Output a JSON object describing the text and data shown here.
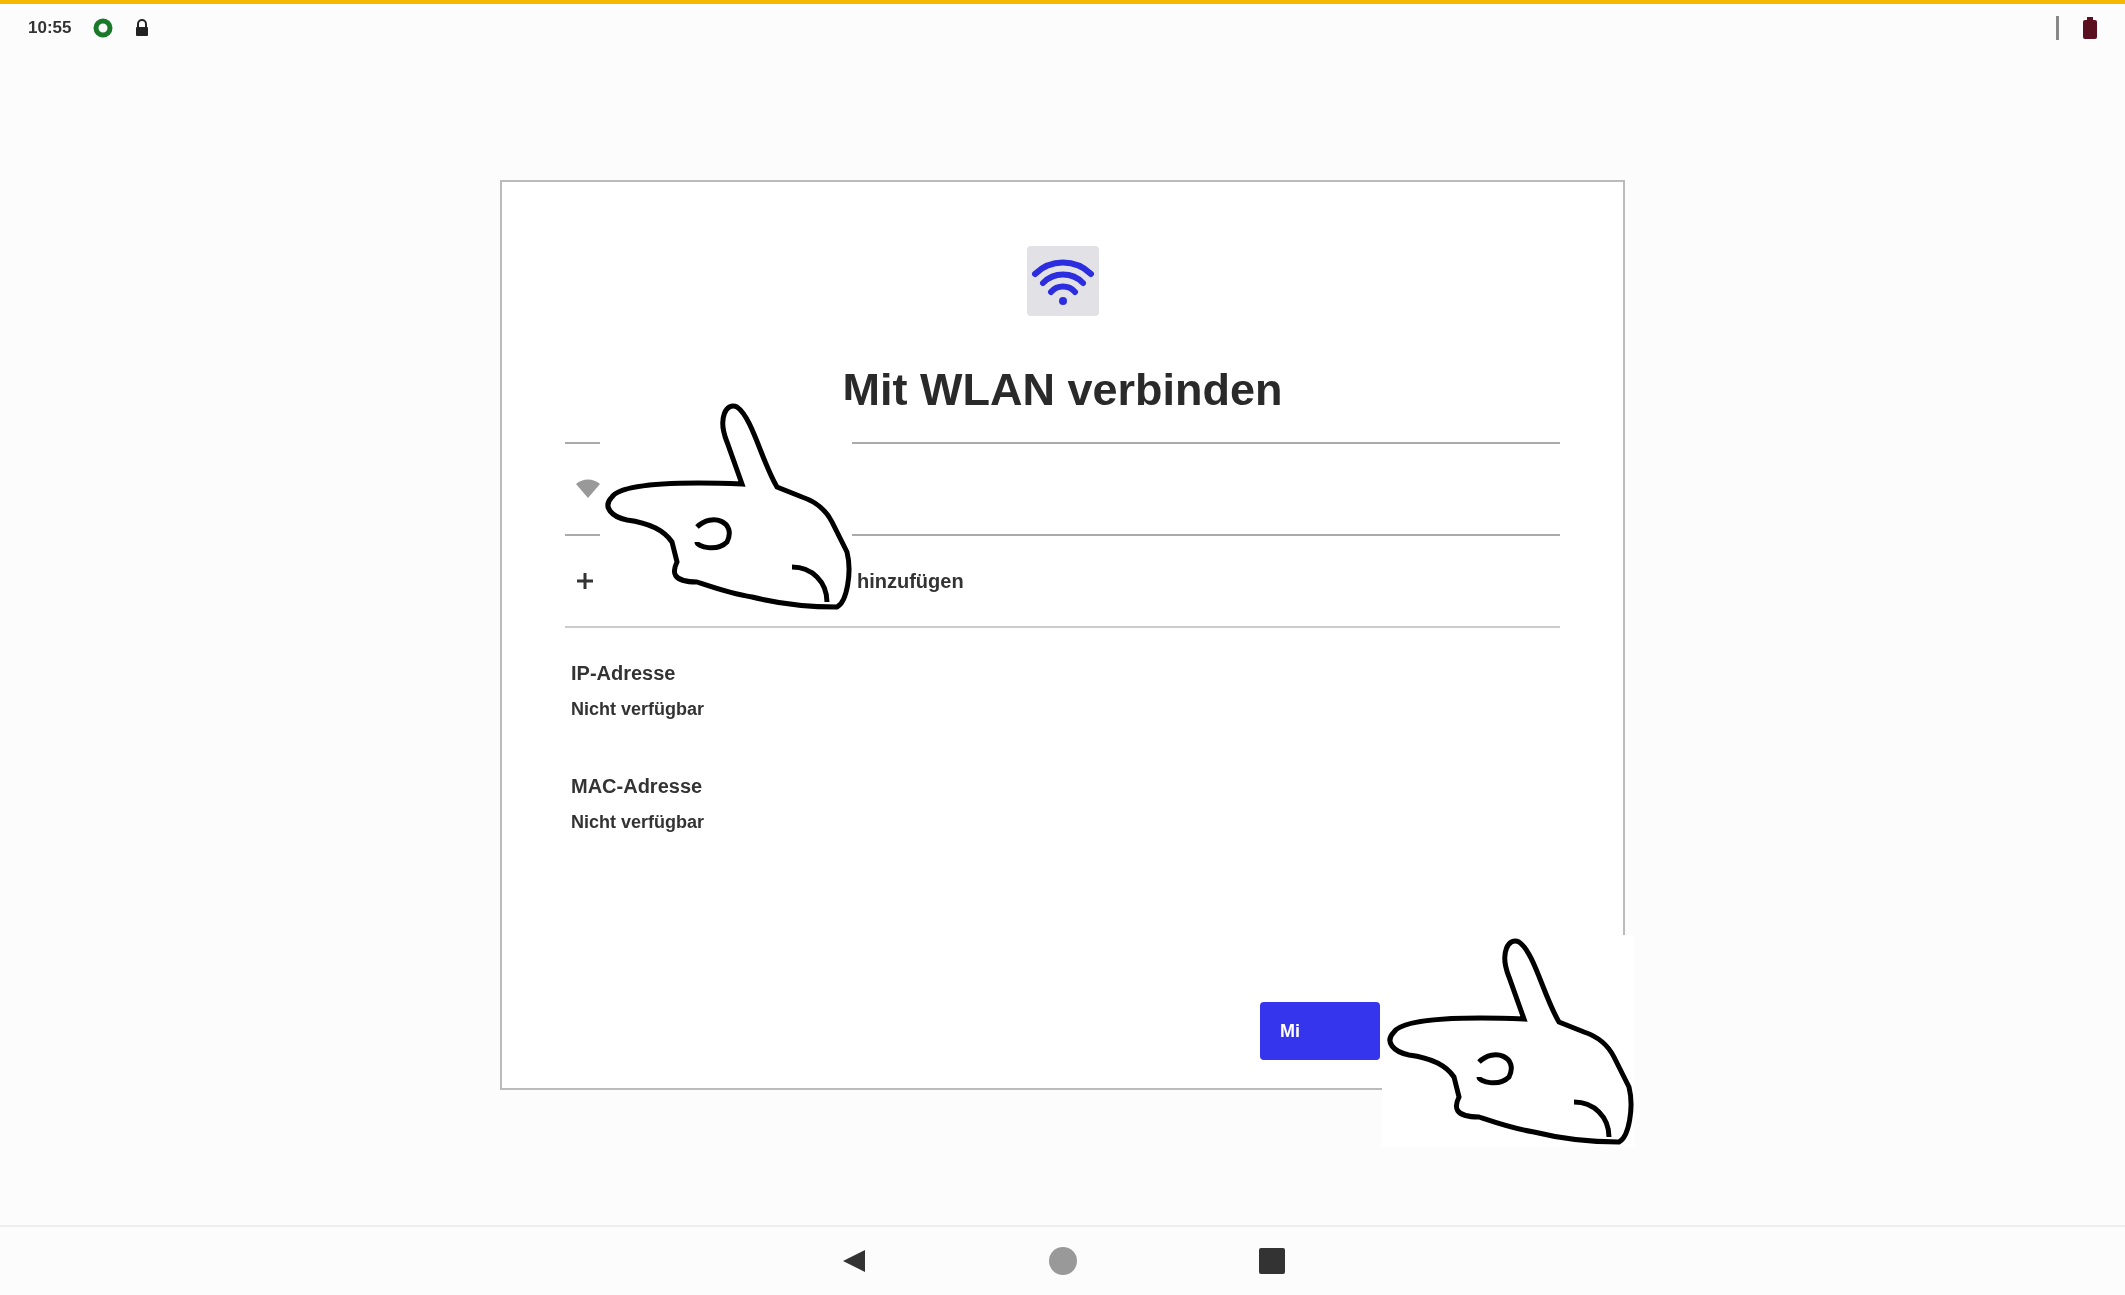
{
  "status_bar": {
    "time": "10:55"
  },
  "dialog": {
    "title": "Mit WLAN verbinden",
    "add_network": {
      "label": "hinzufügen"
    },
    "details": [
      {
        "label": "IP-Adresse",
        "value": "Nicht verfügbar"
      },
      {
        "label": "MAC-Adresse",
        "value": "Nicht verfügbar"
      }
    ],
    "button": {
      "label": "Mi"
    }
  }
}
